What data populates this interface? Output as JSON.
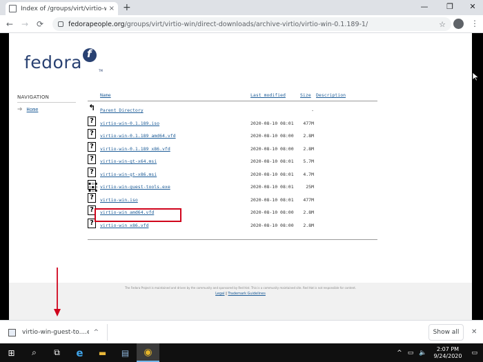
{
  "browser": {
    "tab_title": "Index of /groups/virt/virtio-win/d",
    "tab_close": "×",
    "new_tab": "+",
    "win_minimize": "—",
    "win_restore": "❐",
    "win_close": "✕",
    "url_host": "fedorapeople.org",
    "url_path": "/groups/virt/virtio-win/direct-downloads/archive-virtio/virtio-win-0.1.189-1/",
    "back": "←",
    "forward": "→",
    "reload": "⟳",
    "star": "☆",
    "menu": "⋮"
  },
  "logo": {
    "text": "fedora",
    "badge": "f",
    "tm": "TM"
  },
  "nav": {
    "heading": "NAVIGATION",
    "home": "Home",
    "home_arrow": "➔"
  },
  "listing": {
    "headers": {
      "name": "Name",
      "modified": "Last modified",
      "size": "Size",
      "description": "Description"
    },
    "rows": [
      {
        "name": "Parent Directory",
        "date": "",
        "size": "-",
        "icon": "back-icon"
      },
      {
        "name": "virtio-win-0.1.189.iso",
        "date": "2020-08-10 08:01",
        "size": "477M",
        "icon": "unknown-file-icon"
      },
      {
        "name": "virtio-win-0.1.189_amd64.vfd",
        "date": "2020-08-10 08:00",
        "size": "2.8M",
        "icon": "unknown-file-icon"
      },
      {
        "name": "virtio-win-0.1.189_x86.vfd",
        "date": "2020-08-10 08:00",
        "size": "2.8M",
        "icon": "unknown-file-icon"
      },
      {
        "name": "virtio-win-gt-x64.msi",
        "date": "2020-08-10 08:01",
        "size": "5.7M",
        "icon": "unknown-file-icon"
      },
      {
        "name": "virtio-win-gt-x86.msi",
        "date": "2020-08-10 08:01",
        "size": "4.7M",
        "icon": "unknown-file-icon"
      },
      {
        "name": "virtio-win-guest-tools.exe",
        "date": "2020-08-10 08:01",
        "size": "25M",
        "icon": "binary-file-icon"
      },
      {
        "name": "virtio-win.iso",
        "date": "2020-08-10 08:01",
        "size": "477M",
        "icon": "unknown-file-icon"
      },
      {
        "name": "virtio-win_amd64.vfd",
        "date": "2020-08-10 08:00",
        "size": "2.8M",
        "icon": "unknown-file-icon"
      },
      {
        "name": "virtio-win_x86.vfd",
        "date": "2020-08-10 08:00",
        "size": "2.8M",
        "icon": "unknown-file-icon"
      }
    ]
  },
  "footer": {
    "text": "The Fedora Project is maintained and driven by the community and sponsored by Red Hat. This is a community maintained site. Red Hat is not responsible for content.",
    "legal": "Legal",
    "sep": "|",
    "trademark": "Trademark Guidelines"
  },
  "download_shelf": {
    "file_name": "virtio-win-guest-to....e...",
    "chevron": "^",
    "show_all": "Show all",
    "close": "✕"
  },
  "taskbar": {
    "start": "⊞",
    "search": "⌕",
    "taskview": "⧉",
    "ie": "e",
    "explorer": "▬",
    "server_manager": "▤",
    "chrome": "◉",
    "tray_chevron": "^",
    "tray_network": "▭",
    "tray_volume": "🔈",
    "time": "2:07 PM",
    "date": "9/24/2020",
    "notification": "▭"
  },
  "colors": {
    "annotation_red": "#d0021b",
    "fedora_blue": "#294172",
    "link_blue": "#1a5a96"
  }
}
